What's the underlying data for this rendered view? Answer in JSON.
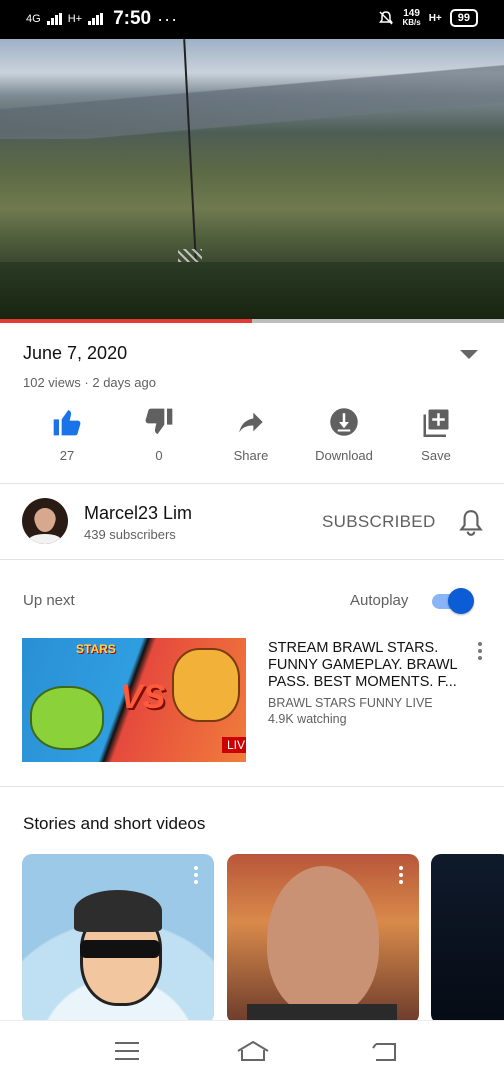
{
  "status_bar": {
    "net1": "4G",
    "net2": "H+",
    "time": "7:50",
    "dots": "···",
    "speed_value": "149",
    "speed_unit": "KB/s",
    "net3": "H+",
    "battery": "99"
  },
  "video": {
    "progress_fraction": 0.5,
    "accent_color": "#e53935"
  },
  "details": {
    "title": "June 7, 2020",
    "meta": "102 views · 2 days ago"
  },
  "actions": [
    {
      "icon": "thumbs-up-icon",
      "label": "27"
    },
    {
      "icon": "thumbs-down-icon",
      "label": "0"
    },
    {
      "icon": "share-icon",
      "label": "Share"
    },
    {
      "icon": "download-icon",
      "label": "Download"
    },
    {
      "icon": "add-to-playlist-icon",
      "label": "Save"
    }
  ],
  "channel": {
    "name": "Marcel23 Lim",
    "subscribers": "439 subscribers",
    "subscribe_label": "SUBSCRIBED"
  },
  "up_next": {
    "label": "Up next",
    "autoplay_label": "Autoplay",
    "autoplay_on": true,
    "item": {
      "title": "STREAM BRAWL STARS. FUNNY GAMEPLAY. BRAWL PASS. BEST MOMENTS. F...",
      "channel": "BRAWL STARS FUNNY LIVE",
      "watching": "4.9K watching",
      "badge": "LIVE",
      "thumb_logo": "STARS",
      "thumb_vs": "VS"
    }
  },
  "stories": {
    "title": "Stories and short videos"
  }
}
